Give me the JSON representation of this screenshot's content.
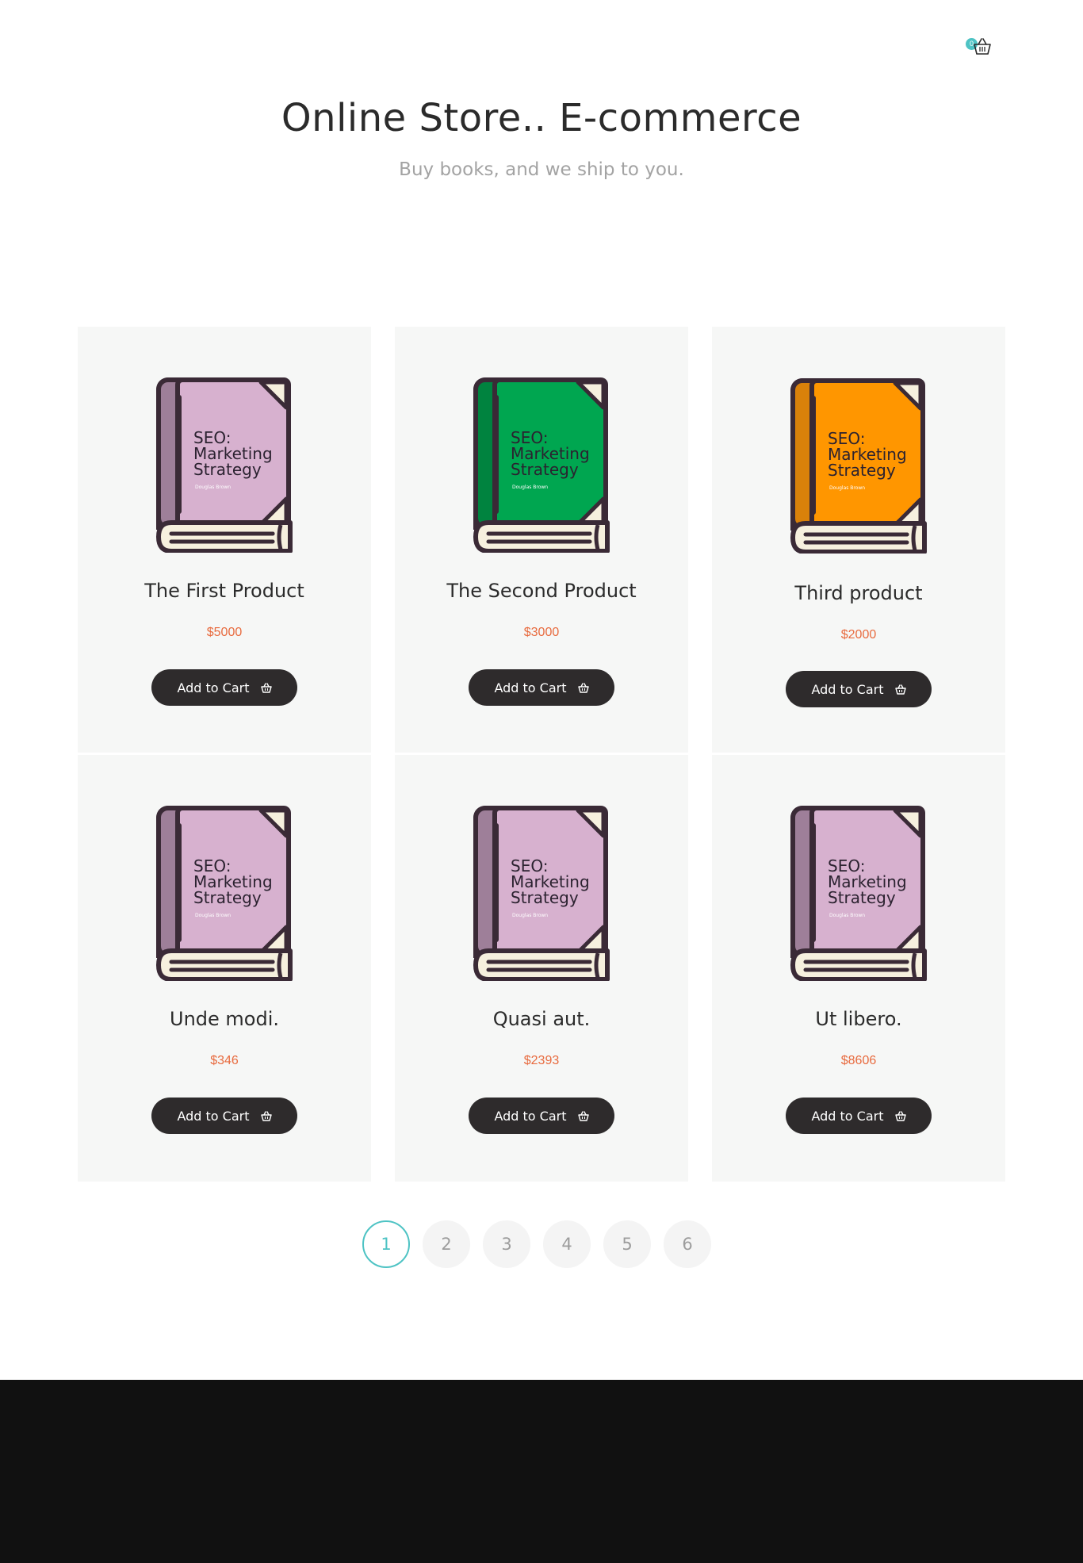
{
  "header": {
    "cart_count": "0",
    "cart_icon": "basket-icon"
  },
  "hero": {
    "title": "Online Store.. E-commerce",
    "subtitle": "Buy books, and we ship to you."
  },
  "book_cover": {
    "title_line1": "SEO:",
    "title_line2": "Marketing",
    "title_line3": "Strategy",
    "author": "Douglas Brown"
  },
  "products": [
    {
      "name": "The First Product",
      "price": "$5000",
      "cover_color": "#d7b1cf",
      "spine_color": "#9e7f99",
      "button": "Add to Cart"
    },
    {
      "name": "The Second Product",
      "price": "$3000",
      "cover_color": "#00a650",
      "spine_color": "#00833f",
      "button": "Add to Cart"
    },
    {
      "name": "Third product",
      "price": "$2000",
      "cover_color": "#ff9600",
      "spine_color": "#d9810a",
      "button": "Add to Cart"
    },
    {
      "name": "Unde modi.",
      "price": "$346",
      "cover_color": "#d7b1cf",
      "spine_color": "#9e7f99",
      "button": "Add to Cart"
    },
    {
      "name": "Quasi aut.",
      "price": "$2393",
      "cover_color": "#d7b1cf",
      "spine_color": "#9e7f99",
      "button": "Add to Cart"
    },
    {
      "name": "Ut libero.",
      "price": "$8606",
      "cover_color": "#d7b1cf",
      "spine_color": "#9e7f99",
      "button": "Add to Cart"
    }
  ],
  "pagination": {
    "pages": [
      "1",
      "2",
      "3",
      "4",
      "5",
      "6"
    ],
    "current": "1"
  },
  "colors": {
    "accent": "#4ec3c4",
    "price": "#e86b3f",
    "button": "#2e2b2c",
    "card_bg": "#f6f7f6",
    "footer_bg": "#111111"
  }
}
